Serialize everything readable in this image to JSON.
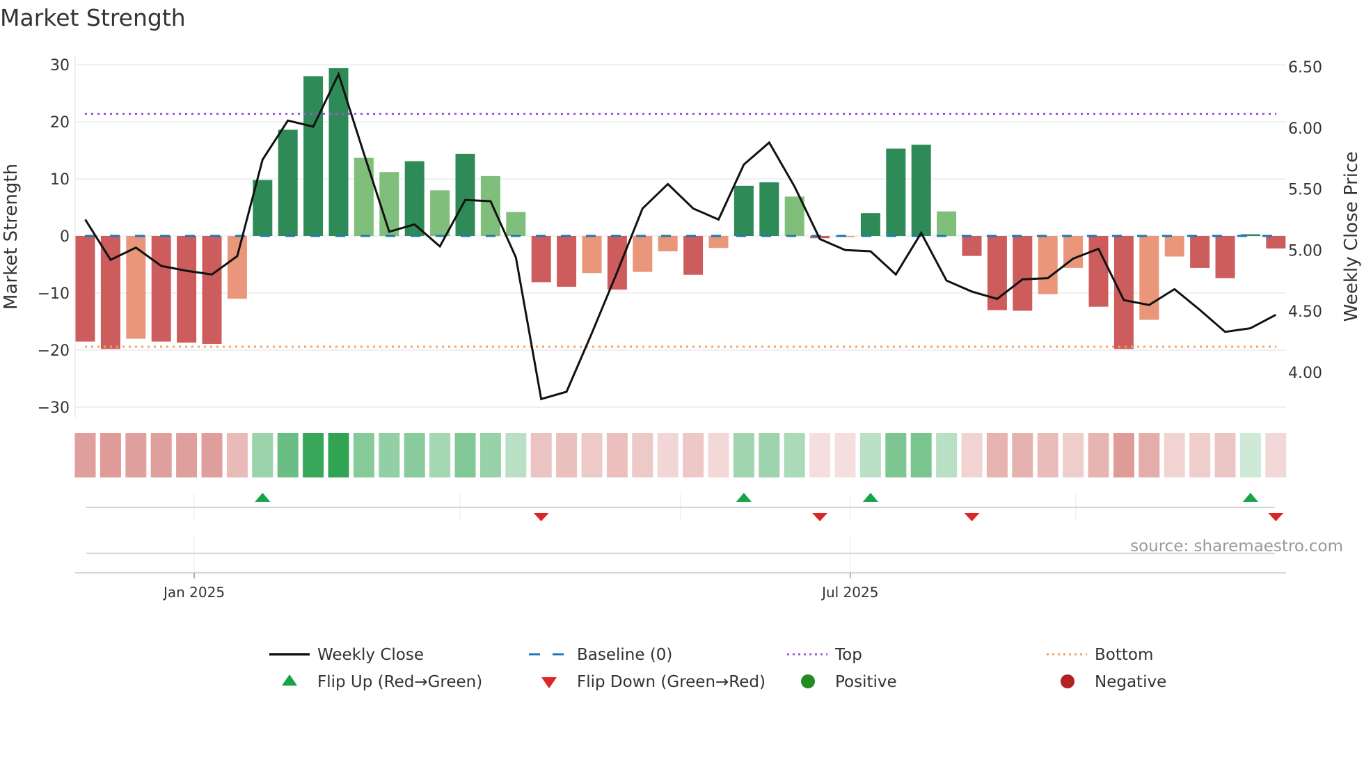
{
  "chart_data": {
    "type": "bar",
    "title": "Market Strength",
    "ylabel": "Market Strength",
    "y2label": "Weekly Close Price",
    "ylim": [
      -32,
      32
    ],
    "y2lim": [
      3.72,
      6.55
    ],
    "yticks": [
      "30",
      "20",
      "10",
      "0",
      "−10",
      "−20",
      "−30"
    ],
    "ytick_values": [
      30,
      20,
      10,
      0,
      -10,
      -20,
      -30
    ],
    "y2ticks": [
      "6.50",
      "6.00",
      "5.50",
      "5.00",
      "4.50",
      "4.00"
    ],
    "y2tick_values": [
      6.5,
      6.0,
      5.5,
      5.0,
      4.5,
      4.0
    ],
    "xticks": [
      {
        "label": "Jan 2025",
        "week": 4.3
      },
      {
        "label": "Jul 2025",
        "week": 30.2
      }
    ],
    "minor_grid_weeks": [
      4.3,
      14.8,
      23.5,
      30.2,
      39.1
    ],
    "strength": [
      -18.5,
      -19.8,
      -18.0,
      -18.5,
      -18.7,
      -18.9,
      -11.0,
      9.8,
      18.6,
      28.0,
      29.4,
      13.7,
      11.2,
      13.1,
      8.0,
      14.4,
      10.5,
      4.2,
      -8.1,
      -8.9,
      -6.5,
      -9.4,
      -6.3,
      -2.7,
      -6.8,
      -2.1,
      8.8,
      9.4,
      6.9,
      -0.4,
      -0.2,
      4.0,
      15.3,
      16.0,
      4.3,
      -3.5,
      -13.0,
      -13.1,
      -10.2,
      -5.6,
      -12.4,
      -19.8,
      -14.7,
      -3.6,
      -5.6,
      -7.4,
      0.3,
      -2.2
    ],
    "strong": [
      1,
      1,
      0,
      1,
      1,
      1,
      0,
      1,
      1,
      1,
      1,
      0,
      0,
      1,
      0,
      1,
      0,
      0,
      1,
      1,
      0,
      1,
      0,
      0,
      1,
      0,
      1,
      1,
      0,
      1,
      0,
      1,
      1,
      1,
      0,
      1,
      1,
      1,
      0,
      0,
      1,
      1,
      0,
      0,
      1,
      1,
      1,
      1
    ],
    "weekly_close": [
      5.25,
      4.92,
      5.02,
      4.87,
      4.83,
      4.8,
      4.95,
      5.74,
      6.06,
      6.01,
      6.44,
      5.79,
      5.15,
      5.21,
      5.03,
      5.41,
      5.4,
      4.94,
      3.78,
      3.84,
      4.32,
      4.82,
      5.34,
      5.54,
      5.34,
      5.25,
      5.7,
      5.88,
      5.52,
      5.09,
      5.0,
      4.99,
      4.8,
      5.14,
      4.75,
      4.66,
      4.6,
      4.76,
      4.77,
      4.93,
      5.01,
      4.59,
      4.55,
      4.68,
      4.51,
      4.33,
      4.36,
      4.47
    ],
    "top": 21.4,
    "bottom": -19.4,
    "baseline": 0,
    "flip_up_weeks": [
      7,
      26,
      31,
      46
    ],
    "flip_down_weeks": [
      18,
      29,
      35,
      47
    ],
    "colors": {
      "strong_pos": "#2e8b57",
      "weak_pos": "#7fbf7b",
      "strong_neg": "#cd5c5c",
      "weak_neg": "#e9967a",
      "line": "#111111",
      "baseline": "#1f77b4",
      "top": "#9b59e8",
      "bottom": "#f4a261",
      "flip_up": "#16a34a",
      "flip_down": "#dc2626",
      "positive": "#228b22",
      "negative": "#b22222"
    },
    "legend": [
      {
        "label": "Weekly Close",
        "kind": "line"
      },
      {
        "label": "Baseline (0)",
        "kind": "dash"
      },
      {
        "label": "Top",
        "kind": "dot-top"
      },
      {
        "label": "Bottom",
        "kind": "dot-bottom"
      },
      {
        "label": "Flip Up (Red→Green)",
        "kind": "tri-up"
      },
      {
        "label": "Flip Down (Green→Red)",
        "kind": "tri-down"
      },
      {
        "label": "Positive",
        "kind": "circle-pos"
      },
      {
        "label": "Negative",
        "kind": "circle-neg"
      }
    ],
    "source": "source: sharemaestro.com"
  }
}
